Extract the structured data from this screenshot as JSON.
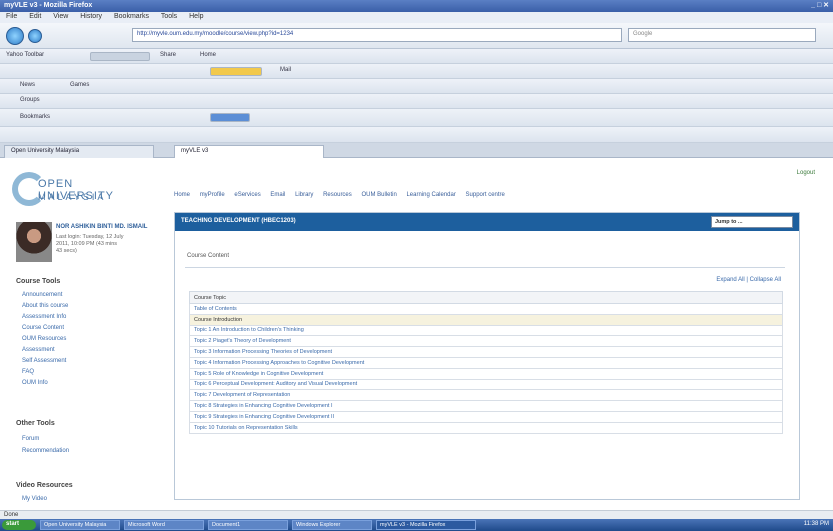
{
  "window": {
    "title": "myVLE v3 - Mozilla Firefox"
  },
  "menu": [
    "File",
    "Edit",
    "View",
    "History",
    "Bookmarks",
    "Tools",
    "Help"
  ],
  "address": {
    "url": "http://myvle.oum.edu.my/moodle/course/view.php?id=1234"
  },
  "search": {
    "placeholder": "Google"
  },
  "toolbar": {
    "search_value": "Yahoo Toolbar",
    "labels": [
      "Share",
      "Home",
      "Mail",
      "News",
      "Games",
      "Groups",
      "Bookmarks"
    ]
  },
  "tabs": [
    {
      "label": "Open University Malaysia"
    },
    {
      "label": "myVLE v3"
    }
  ],
  "site": {
    "logo_line1": "OPEN UNIVERSITY",
    "logo_line2": "MALAYSIA",
    "nav": [
      "Home",
      "myProfile",
      "eServices",
      "Email",
      "Library",
      "Resources",
      "OUM Bulletin",
      "Learning Calendar",
      "Support centre"
    ],
    "user_top": "Logout"
  },
  "profile": {
    "name": "NOR ASHIKIN BINTI MD. ISMAIL",
    "info": [
      "Last login: Tuesday, 12 July",
      "2011, 10:09 PM (43 mins",
      "43 secs)"
    ]
  },
  "sidebar": {
    "tools_title": "Course Tools",
    "tools": [
      "Announcement",
      "About this course",
      "Assessment Info",
      "Course Content",
      "OUM Resources",
      "Assessment",
      "Self Assessment",
      "FAQ",
      "OUM Info"
    ],
    "other_title": "Other Tools",
    "other": [
      "Forum",
      "Recommendation"
    ],
    "video_title": "Video Resources",
    "video": [
      "My Video"
    ]
  },
  "main": {
    "title": "TEACHING DEVELOPMENT (HBEC1203)",
    "jump": "Jump to ...",
    "crumb": "Course Content",
    "right_links": "Expand All | Collapse All",
    "table_header": "Course Topic",
    "rows": [
      "Table of Contents",
      "Course Introduction",
      "Topic 1 An Introduction to Children's Thinking",
      "Topic 2 Piaget's Theory of Development",
      "Topic 3 Information Processing Theories of Development",
      "Topic 4 Information Processing Approaches to Cognitive Development",
      "Topic 5 Role of Knowledge in Cognitive Development",
      "Topic 6 Perceptual Development: Auditory and Visual Development",
      "Topic 7 Development of Representation",
      "Topic 8 Strategies in Enhancing Cognitive Development I",
      "Topic 9 Strategies in Enhancing Cognitive Development II",
      "Topic 10 Tutorials on Representation Skills"
    ],
    "highlight_row": 1
  },
  "status": "Done",
  "taskbar": {
    "start": "start",
    "items": [
      "Open University Malaysia",
      "Microsoft Word",
      "Document1",
      "Windows Explorer",
      "myVLE v3 - Mozilla Firefox"
    ],
    "clock": "11:38 PM"
  }
}
